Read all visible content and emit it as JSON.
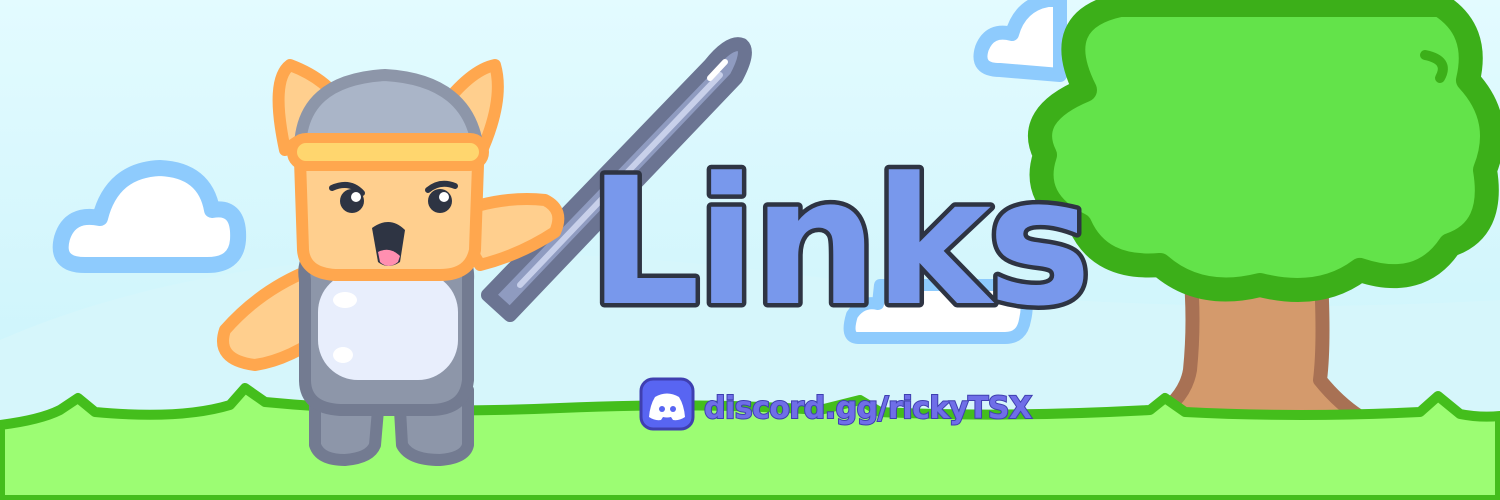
{
  "banner": {
    "title": "Links",
    "discord": {
      "icon": "discord-icon",
      "link_text": "discord.gg/rickyTSX"
    }
  },
  "colors": {
    "sky_top": "#e3fbff",
    "sky_bottom": "#c4f1f9",
    "hill": "#d5f6fa",
    "cloud_fill": "#ffffff",
    "cloud_outline": "#8ecbfd",
    "grass_fill": "#9cfd73",
    "grass_outline": "#44be1c",
    "title_fill": "#7898ec",
    "title_outline": "#2e3443",
    "discord_blue": "#5865f2",
    "tree_leaves": "#63e34a",
    "tree_leaves_outline": "#3caf19",
    "tree_trunk": "#d49a6c",
    "tree_trunk_outline": "#a87154",
    "sword_blade": "#8f9bc0",
    "sword_outline": "#6b7492",
    "character_fur": "#ffcf8e",
    "character_fur_outline": "#ffa74e",
    "character_armor": "#8d96a9",
    "character_helmet": "#aab5c8"
  }
}
